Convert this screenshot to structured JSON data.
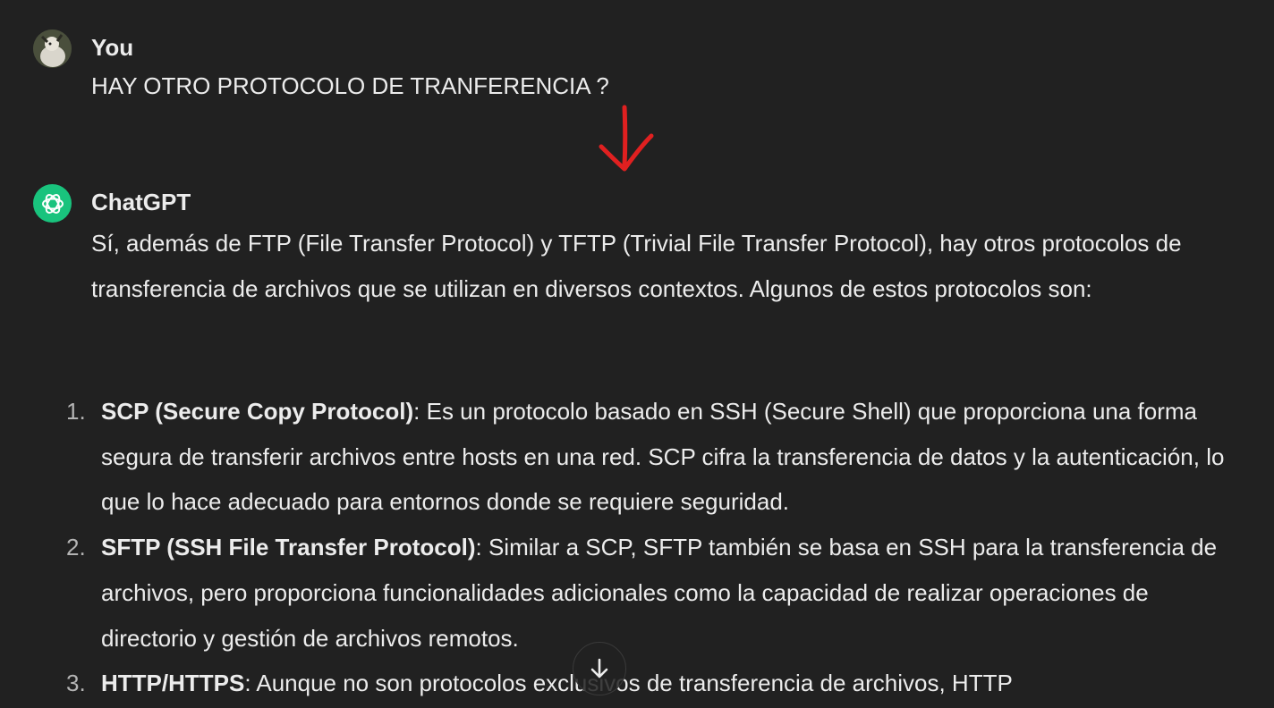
{
  "conversation": {
    "user_message": {
      "author": "You",
      "text": "HAY OTRO PROTOCOLO DE TRANFERENCIA ?",
      "avatar_icon": "user-photo-avatar"
    },
    "assistant_message": {
      "author": "ChatGPT",
      "avatar_icon": "openai-logo-icon",
      "avatar_color": "#19c37d",
      "intro": "Sí, además de FTP (File Transfer Protocol) y TFTP (Trivial File Transfer Protocol), hay otros protocolos de transferencia de archivos que se utilizan en diversos contextos. Algunos de estos protocolos son:",
      "items": [
        {
          "number": "1.",
          "term": "SCP (Secure Copy Protocol)",
          "description": ": Es un protocolo basado en SSH (Secure Shell) que proporciona una forma segura de transferir archivos entre hosts en una red. SCP cifra la transferencia de datos y la autenticación, lo que lo hace adecuado para entornos donde se requiere seguridad."
        },
        {
          "number": "2.",
          "term": "SFTP (SSH File Transfer Protocol)",
          "description": ": Similar a SCP, SFTP también se basa en SSH para la transferencia de archivos, pero proporciona funcionalidades adicionales como la capacidad de realizar operaciones de directorio y gestión de archivos remotos."
        },
        {
          "number": "3.",
          "term": "HTTP/HTTPS",
          "description": ": Aunque no son protocolos exclusivos de transferencia de archivos, HTTP"
        }
      ]
    }
  },
  "overlays": {
    "annotation_arrow_icon": "red-down-arrow-annotation",
    "annotation_color": "#e02020",
    "scroll_button_icon": "arrow-down-icon"
  },
  "theme": {
    "background": "#212121",
    "text": "#ececec",
    "muted": "#b4b4b4"
  }
}
